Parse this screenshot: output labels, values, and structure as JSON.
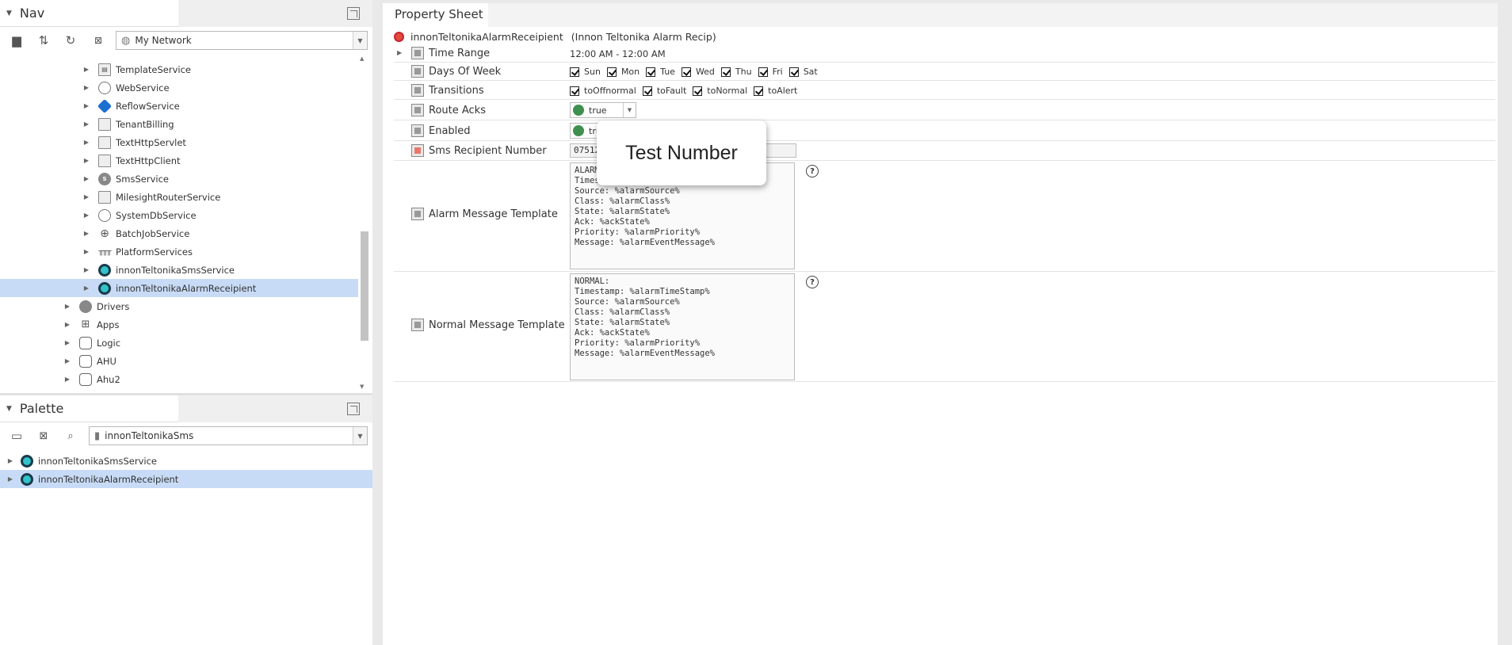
{
  "nav": {
    "title": "Nav",
    "combo_value": "My Network",
    "tree": [
      {
        "label": "TemplateService",
        "icon": "doc-icon",
        "level": 2
      },
      {
        "label": "WebService",
        "icon": "globe-icon",
        "level": 2
      },
      {
        "label": "ReflowService",
        "icon": "reflow-icon",
        "level": 2
      },
      {
        "label": "TenantBilling",
        "icon": "box-icon",
        "level": 2
      },
      {
        "label": "TextHttpServlet",
        "icon": "box-icon",
        "level": 2
      },
      {
        "label": "TextHttpClient",
        "icon": "box-icon",
        "level": 2
      },
      {
        "label": "SmsService",
        "icon": "sms-icon",
        "level": 2
      },
      {
        "label": "MilesightRouterService",
        "icon": "box-icon",
        "level": 2
      },
      {
        "label": "SystemDbService",
        "icon": "globe-icon",
        "level": 2
      },
      {
        "label": "BatchJobService",
        "icon": "batch-icon",
        "level": 2
      },
      {
        "label": "PlatformServices",
        "icon": "platform-icon",
        "level": 2
      },
      {
        "label": "innonTeltonikaSmsService",
        "icon": "teltonika-icon",
        "level": 2
      },
      {
        "label": "innonTeltonikaAlarmReceipient",
        "icon": "teltonika-icon",
        "level": 2,
        "selected": true
      },
      {
        "label": "Drivers",
        "icon": "drivers-icon",
        "level": 1
      },
      {
        "label": "Apps",
        "icon": "apps-icon",
        "level": 1
      },
      {
        "label": "Logic",
        "icon": "folder-icon",
        "level": 1
      },
      {
        "label": "AHU",
        "icon": "folder-icon",
        "level": 1
      },
      {
        "label": "Ahu2",
        "icon": "folder-icon",
        "level": 1
      }
    ]
  },
  "palette": {
    "title": "Palette",
    "combo_value": "innonTeltonikaSms",
    "items": [
      {
        "label": "innonTeltonikaSmsService",
        "selected": false
      },
      {
        "label": "innonTeltonikaAlarmReceipient",
        "selected": true
      }
    ]
  },
  "sheet": {
    "tab": "Property Sheet",
    "object_name": "innonTeltonikaAlarmReceipient",
    "object_type": "(Innon Teltonika Alarm Recip)",
    "time_range": {
      "label": "Time Range",
      "value": "12:00 AM - 12:00 AM"
    },
    "days_of_week": {
      "label": "Days Of Week",
      "days": [
        "Sun",
        "Mon",
        "Tue",
        "Wed",
        "Thu",
        "Fri",
        "Sat"
      ]
    },
    "transitions": {
      "label": "Transitions",
      "items": [
        "toOffnormal",
        "toFault",
        "toNormal",
        "toAlert"
      ]
    },
    "route_acks": {
      "label": "Route Acks",
      "value": "true"
    },
    "enabled": {
      "label": "Enabled",
      "value": "tru"
    },
    "sms_number": {
      "label": "Sms Recipient Number",
      "value": "07512"
    },
    "alarm_template": {
      "label": "Alarm Message Template",
      "text": "ALARM\nTimes\nSource: %alarmSource%\nClass: %alarmClass%\nState: %alarmState%\nAck: %ackState%\nPriority: %alarmPriority%\nMessage: %alarmEventMessage%"
    },
    "normal_template": {
      "label": "Normal Message Template",
      "text": "NORMAL:\nTimestamp: %alarmTimeStamp%\nSource: %alarmSource%\nClass: %alarmClass%\nState: %alarmState%\nAck: %ackState%\nPriority: %alarmPriority%\nMessage: %alarmEventMessage%"
    },
    "help_glyph": "?"
  },
  "tooltip": "Test Number"
}
